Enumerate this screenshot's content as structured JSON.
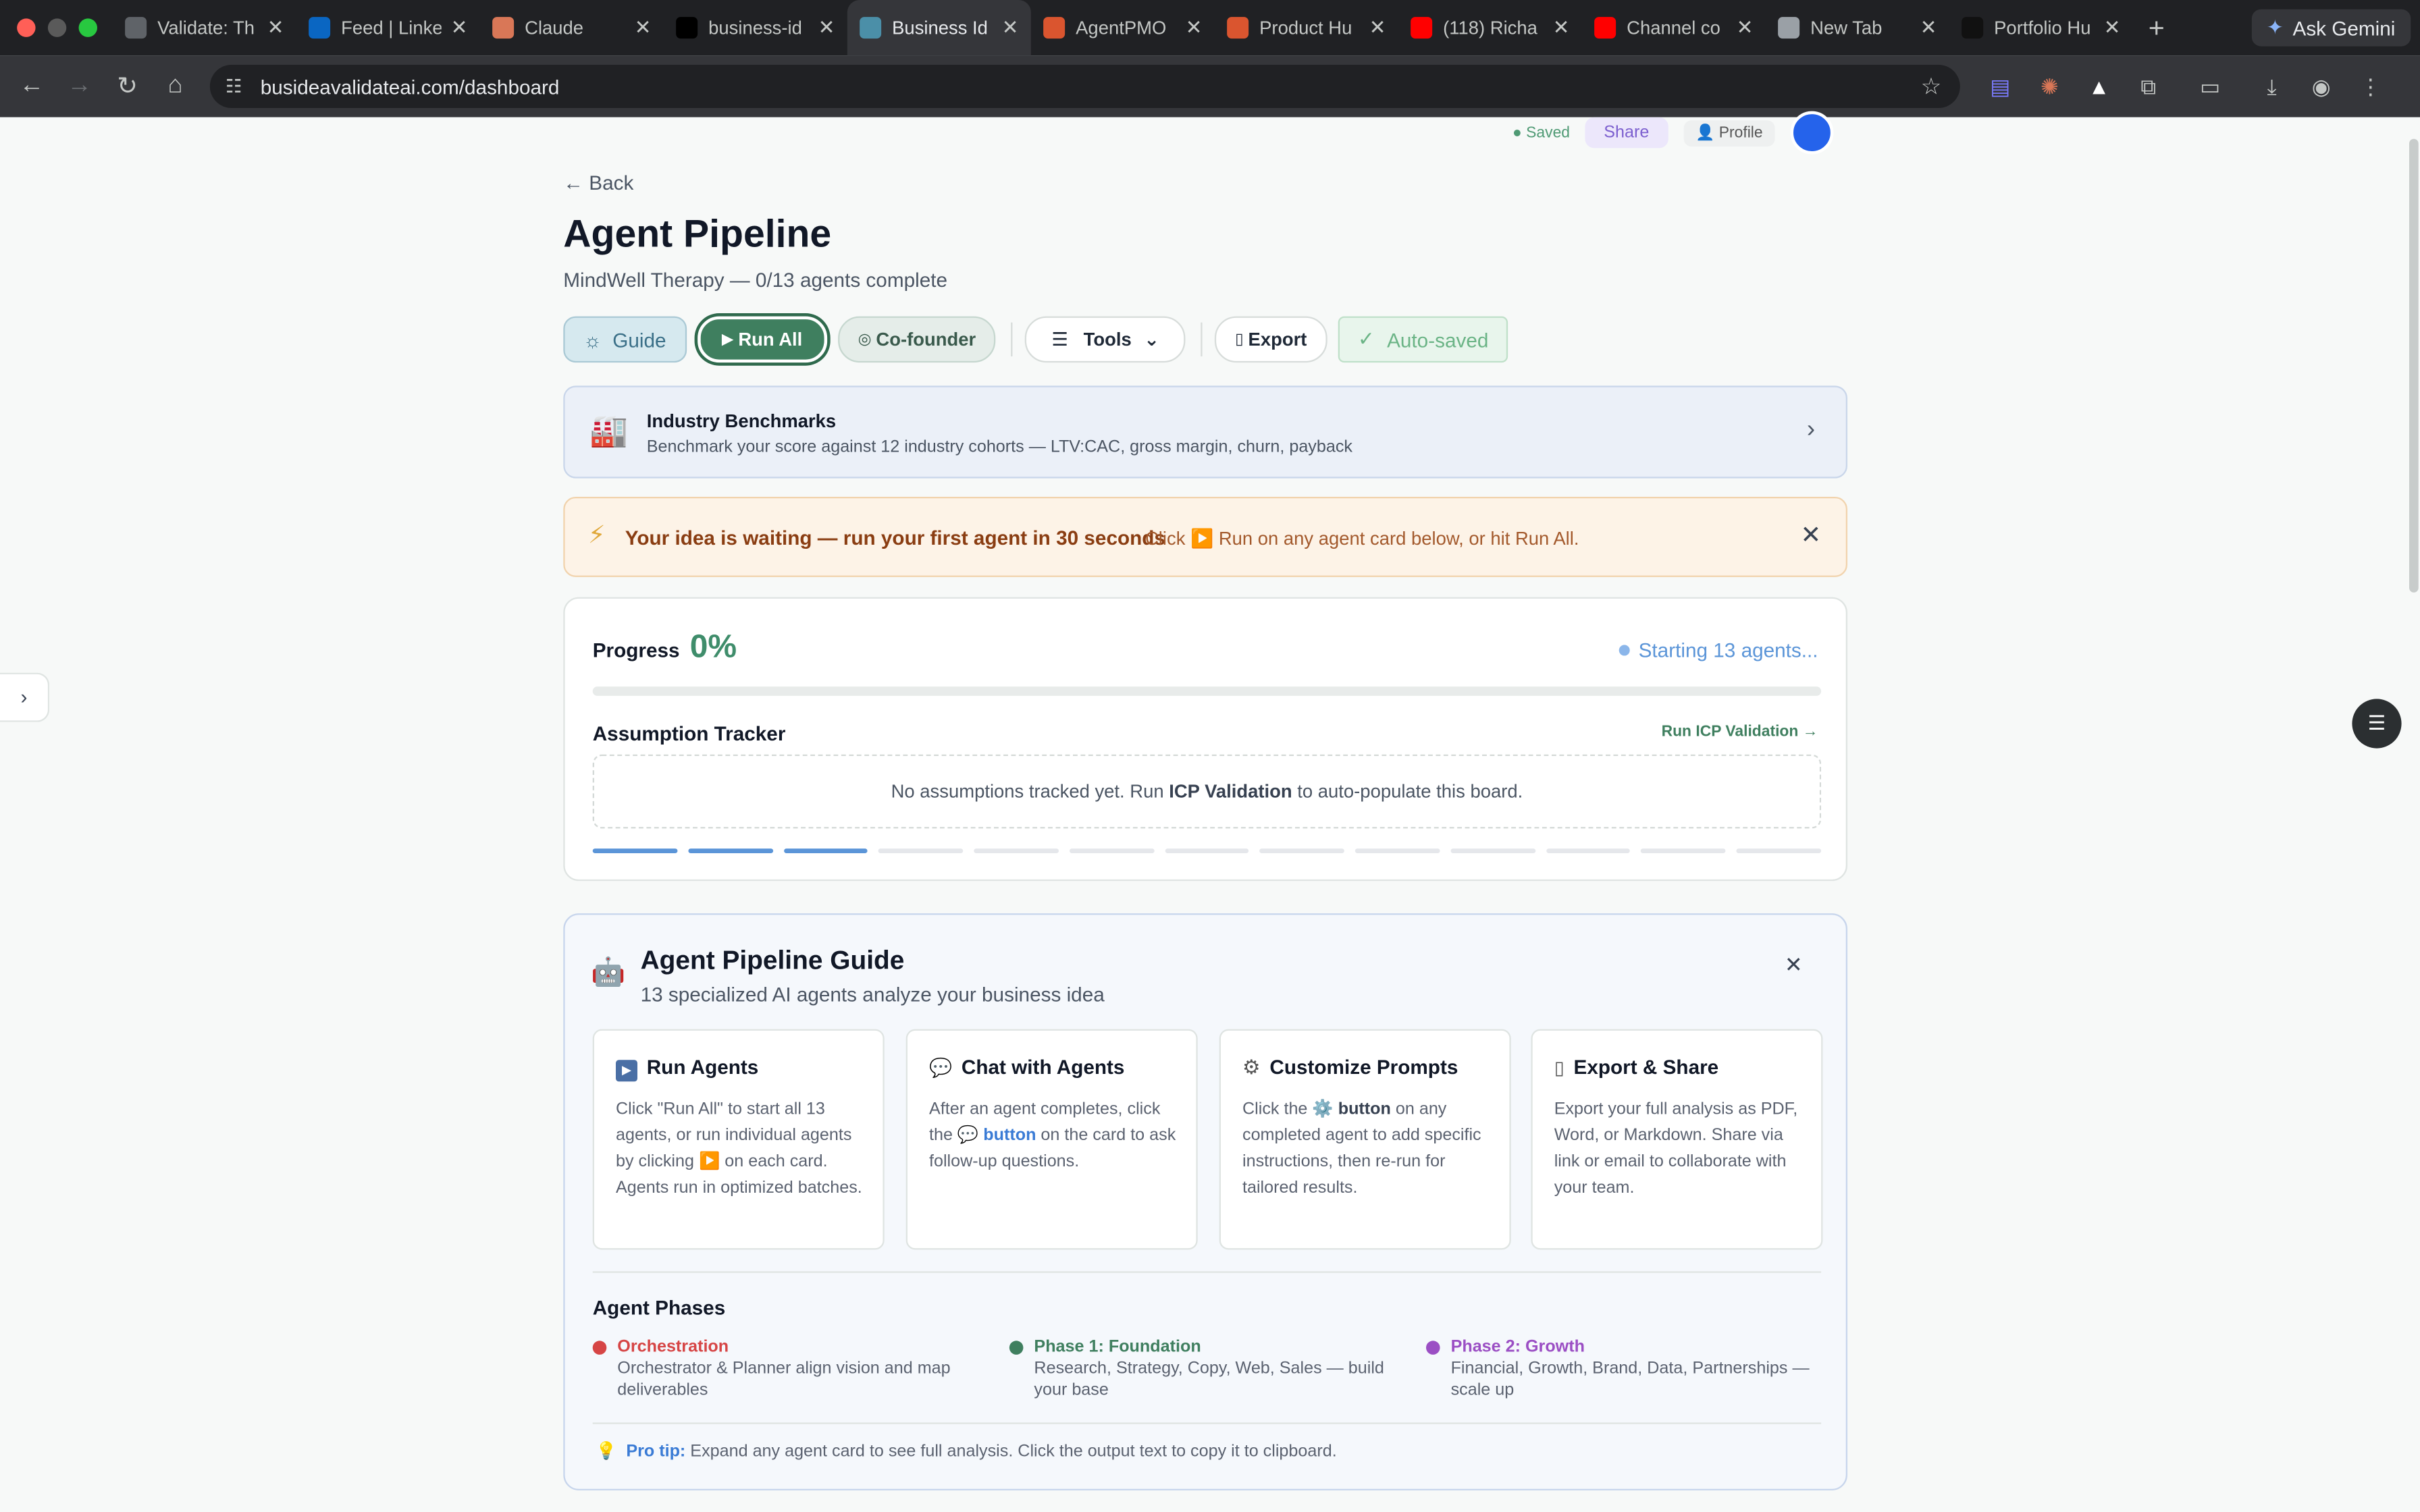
{
  "browser": {
    "tabs": [
      {
        "title": "Validate: Th",
        "color": "#5f6368"
      },
      {
        "title": "Feed | Linke",
        "color": "#0a66c2"
      },
      {
        "title": "Claude",
        "color": "#d97757"
      },
      {
        "title": "business-id",
        "color": "#000000"
      },
      {
        "title": "Business Id",
        "color": "#4b8fa8"
      },
      {
        "title": "AgentPMO",
        "color": "#da552f"
      },
      {
        "title": "Product Hu",
        "color": "#da552f"
      },
      {
        "title": "(118) Richa",
        "color": "#ff0000"
      },
      {
        "title": "Channel co",
        "color": "#ff0000"
      },
      {
        "title": "New Tab",
        "color": "#9aa0a6"
      },
      {
        "title": "Portfolio Hu",
        "color": "#111111"
      }
    ],
    "active_tab": 4,
    "ask_gemini": "Ask Gemini",
    "url": "busideavalidateai.com/dashboard"
  },
  "header": {
    "saved": "Saved",
    "share": "Share",
    "profile": "👤 Profile"
  },
  "page": {
    "back": "← Back",
    "title": "Agent Pipeline",
    "subtitle": "MindWell Therapy — 0/13 agents complete",
    "buttons": {
      "guide": "Guide",
      "run_all": "Run All",
      "cofounder": "Co-founder",
      "tools": "Tools",
      "export": "Export",
      "autosaved": "Auto-saved"
    }
  },
  "benchmarks": {
    "title": "Industry Benchmarks",
    "description": "Benchmark your score against 12 industry cohorts — LTV:CAC, gross margin, churn, payback"
  },
  "alert": {
    "message": "Your idea is waiting — run your first agent in 30 seconds",
    "hint": "Click ▶️ Run on any agent card below, or hit Run All."
  },
  "progress": {
    "label": "Progress",
    "value": "0%",
    "fraction": 0,
    "status": "Starting 13 agents...",
    "tracker_title": "Assumption Tracker",
    "tracker_link": "Run ICP Validation →",
    "empty_prefix": "No assumptions tracked yet. Run ",
    "empty_bold": "ICP Validation",
    "empty_suffix": " to auto-populate this board.",
    "segments_total": 13,
    "segments_active": 3
  },
  "guide": {
    "title": "Agent Pipeline Guide",
    "subtitle": "13 specialized AI agents analyze your business idea",
    "columns": [
      {
        "title": "Run Agents",
        "icon": "play-icon"
      },
      {
        "title": "Chat with Agents",
        "icon": "chat-icon"
      },
      {
        "title": "Customize Prompts",
        "icon": "gear-icon"
      },
      {
        "title": "Export & Share",
        "icon": "document-icon"
      }
    ],
    "col1_text": "Click \"Run All\" to start all 13 agents, or run individual agents by clicking ▶️ on each card. Agents run in optimized batches.",
    "col2_a": "After an agent completes, click the 💬 ",
    "col2_b": "button",
    "col2_c": " on the card to ask follow-up questions.",
    "col3_a": "Click the ⚙️ ",
    "col3_b": "button",
    "col3_c": " on any completed agent to add specific instructions, then re-run for tailored results.",
    "col4_text": "Export your full analysis as PDF, Word, or Markdown. Share via link or email to collaborate with your team.",
    "phases_title": "Agent Phases",
    "phases": [
      {
        "title": "Orchestration",
        "desc": "Orchestrator & Planner align vision and map deliverables",
        "color": "#d64545"
      },
      {
        "title": "Phase 1: Foundation",
        "desc": "Research, Strategy, Copy, Web, Sales — build your base",
        "color": "#3f7f5f"
      },
      {
        "title": "Phase 2: Growth",
        "desc": "Financial, Growth, Brand, Data, Partnerships — scale up",
        "color": "#9b4fc4"
      }
    ],
    "tip_label": "Pro tip:",
    "tip_text": " Expand any agent card to see full analysis. Click the output text to copy it to clipboard."
  }
}
